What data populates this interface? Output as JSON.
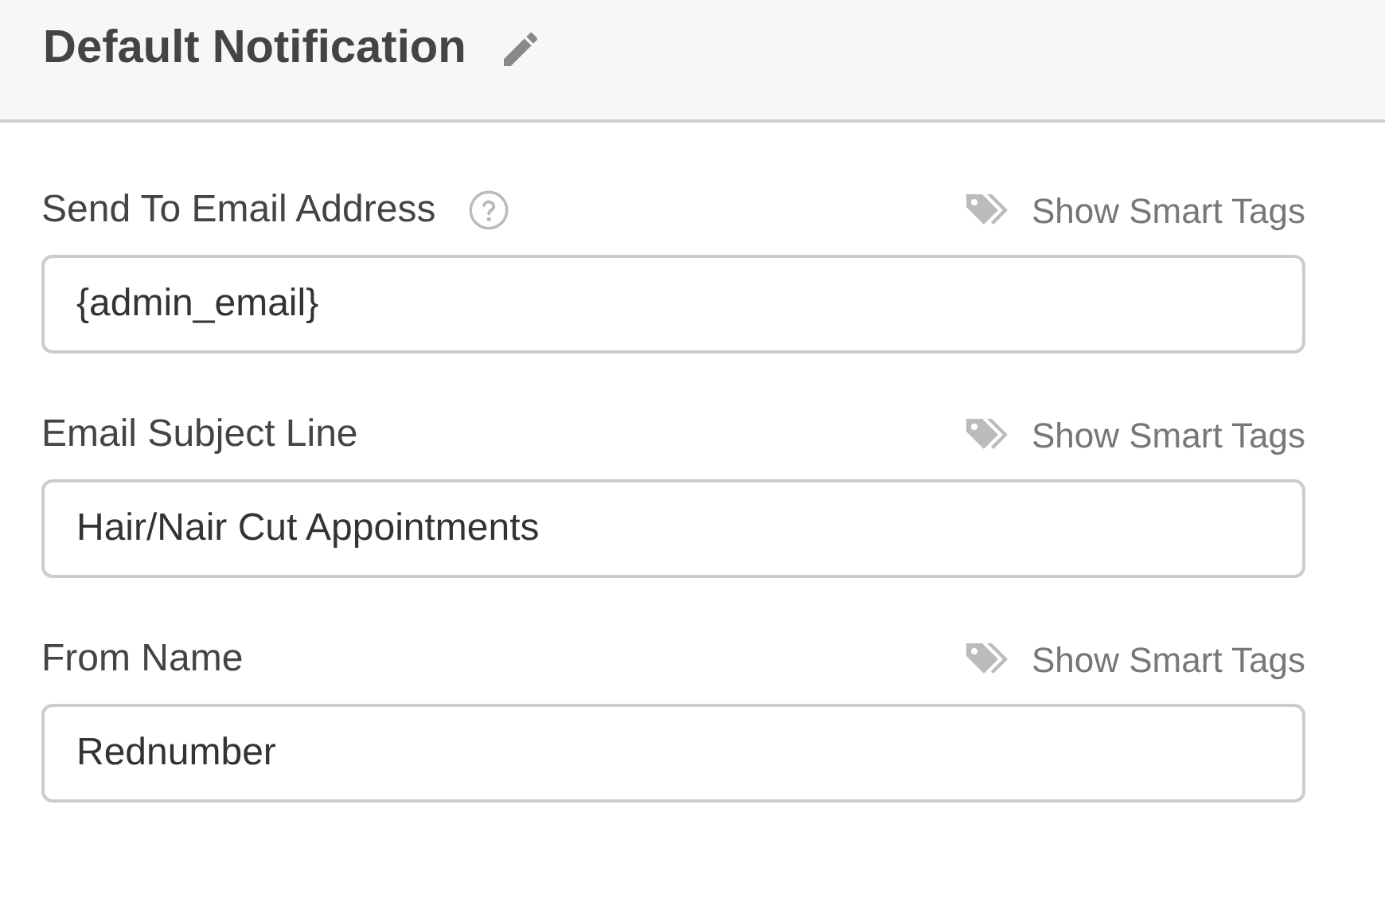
{
  "header": {
    "title": "Default Notification"
  },
  "fields": [
    {
      "label": "Send To Email Address",
      "help": true,
      "smart_tags": "Show Smart Tags",
      "value": "{admin_email}"
    },
    {
      "label": "Email Subject Line",
      "help": false,
      "smart_tags": "Show Smart Tags",
      "value": "Hair/Nair Cut Appointments"
    },
    {
      "label": "From Name",
      "help": false,
      "smart_tags": "Show Smart Tags",
      "value": "Rednumber"
    }
  ]
}
